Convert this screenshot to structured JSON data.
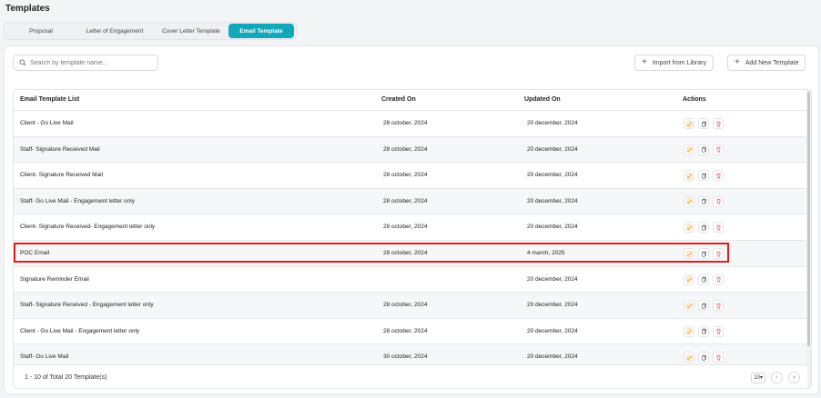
{
  "page": {
    "title": "Templates"
  },
  "tabs": [
    {
      "label": "Proposal",
      "active": false
    },
    {
      "label": "Letter of Engagement",
      "active": false
    },
    {
      "label": "Cover Letter Template",
      "active": false
    },
    {
      "label": "Email Template",
      "active": true
    }
  ],
  "toolbar": {
    "search_placeholder": "Search by template name...",
    "import_label": "Import from Library",
    "add_label": "Add New Template"
  },
  "table": {
    "columns": [
      "Email Template List",
      "Created On",
      "Updated On",
      "Actions"
    ],
    "rows": [
      {
        "name": "Client - Go Live Mail",
        "created": "28 october, 2024",
        "updated": "20 december, 2024"
      },
      {
        "name": "Staff- Signature Received Mail",
        "created": "28 october, 2024",
        "updated": "20 december, 2024"
      },
      {
        "name": "Client- Signature Received Mail",
        "created": "28 october, 2024",
        "updated": "20 december, 2024"
      },
      {
        "name": "Staff- Go Live Mail - Engagement letter only",
        "created": "28 october, 2024",
        "updated": "20 december, 2024"
      },
      {
        "name": "Client- Signature Received- Engagement letter only",
        "created": "28 october, 2024",
        "updated": "20 december, 2024"
      },
      {
        "name": "POC Email",
        "created": "28 october, 2024",
        "updated": "4 march, 2025"
      },
      {
        "name": "Signature Reminder Email",
        "created": "",
        "updated": "20 december, 2024"
      },
      {
        "name": "Staff- Signature Received - Engagement letter only",
        "created": "28 october, 2024",
        "updated": "20 december, 2024"
      },
      {
        "name": "Client - Go Live Mail - Engagement letter only",
        "created": "28 october, 2024",
        "updated": "20 december, 2024"
      },
      {
        "name": "Staff- Go Live Mail",
        "created": "30 october, 2024",
        "updated": "20 december, 2024"
      }
    ]
  },
  "footer": {
    "summary": "1 - 10 of Total 20 Template(s)",
    "page_size": "10"
  },
  "colors": {
    "accent": "#12a8ba",
    "edit_icon": "#f0a23a",
    "copy_icon": "#555555",
    "delete_icon": "#e5484d",
    "highlight": "#e51b1b"
  },
  "icons": {
    "search": "search-icon",
    "edit": "edit-icon",
    "copy": "copy-icon",
    "delete": "trash-icon",
    "prev": "chevron-left-icon",
    "next": "chevron-right-icon"
  }
}
